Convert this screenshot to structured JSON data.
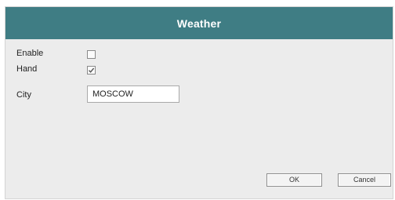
{
  "dialog": {
    "title": "Weather"
  },
  "form": {
    "enable_label": "Enable",
    "enable_checked": false,
    "hand_label": "Hand",
    "hand_checked": true,
    "city_label": "City",
    "city_value": "MOSCOW"
  },
  "buttons": {
    "ok_label": "OK",
    "cancel_label": "Cancel"
  },
  "colors": {
    "titlebar": "#3f7d84",
    "dialog_background": "#ececec"
  }
}
